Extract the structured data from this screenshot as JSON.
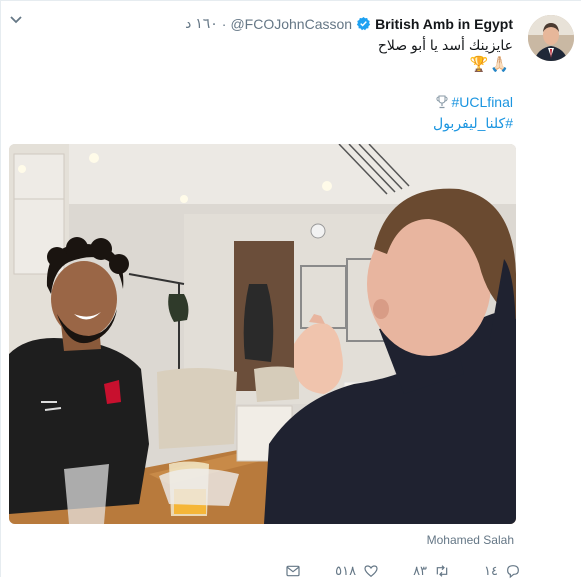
{
  "tweet": {
    "author_name": "British Amb in Egypt",
    "handle": "@FCOJohnCasson",
    "timestamp": "١٦٠ د",
    "text": "عايزينك أسد يا أبو صلاح",
    "emoji": [
      "🏆",
      "🙏🏻"
    ],
    "hashtags": [
      "#UCLfinal",
      "#كلنا_ليفربول"
    ],
    "media_credit": "Mohamed Salah"
  },
  "actions": {
    "reply_count": "١٤",
    "retweet_count": "٨٣",
    "like_count": "٥١٨"
  },
  "icons": {
    "menu": "chevron-down-icon",
    "verified": "verified-badge-icon",
    "reply": "reply-icon",
    "retweet": "retweet-icon",
    "like": "heart-icon",
    "message": "envelope-icon"
  },
  "colors": {
    "link": "#1b95e0",
    "muted": "#657786",
    "verified": "#1da1f2"
  }
}
